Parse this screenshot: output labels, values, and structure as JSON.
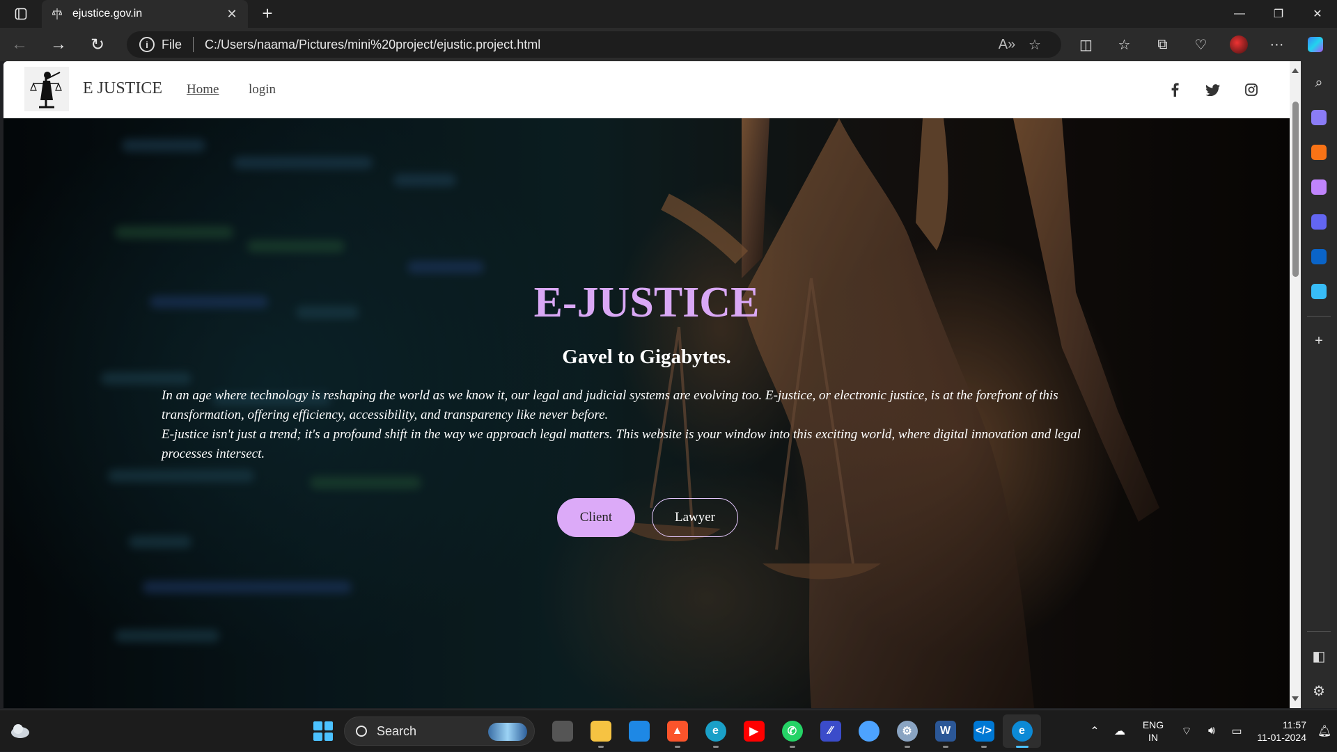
{
  "browser": {
    "tab_title": "ejustice.gov.in",
    "address_prefix": "File",
    "url": "C:/Users/naama/Pictures/mini%20project/ejustic.project.html"
  },
  "site": {
    "brand": "E JUSTICE",
    "nav": {
      "home": "Home",
      "login": "login"
    },
    "social": [
      "facebook-icon",
      "twitter-icon",
      "instagram-icon"
    ]
  },
  "hero": {
    "title": "E-JUSTICE",
    "subtitle": "Gavel to Gigabytes.",
    "paragraph1": "In an age where technology is reshaping the world as we know it, our legal and judicial systems are evolving too. E-justice, or electronic justice, is at the forefront of this transformation, offering efficiency, accessibility, and transparency like never before.",
    "paragraph2": "E-justice isn't just a trend; it's a profound shift in the way we approach legal matters. This website is your window into this exciting world, where digital innovation and legal processes intersect.",
    "client_button": "Client",
    "lawyer_button": "Lawyer",
    "title_color": "#d9a8f5",
    "client_color": "#dcaaf8"
  },
  "taskbar": {
    "search_label": "Search",
    "lang_line1": "ENG",
    "lang_line2": "IN",
    "time": "11:57",
    "date": "11-01-2024"
  }
}
